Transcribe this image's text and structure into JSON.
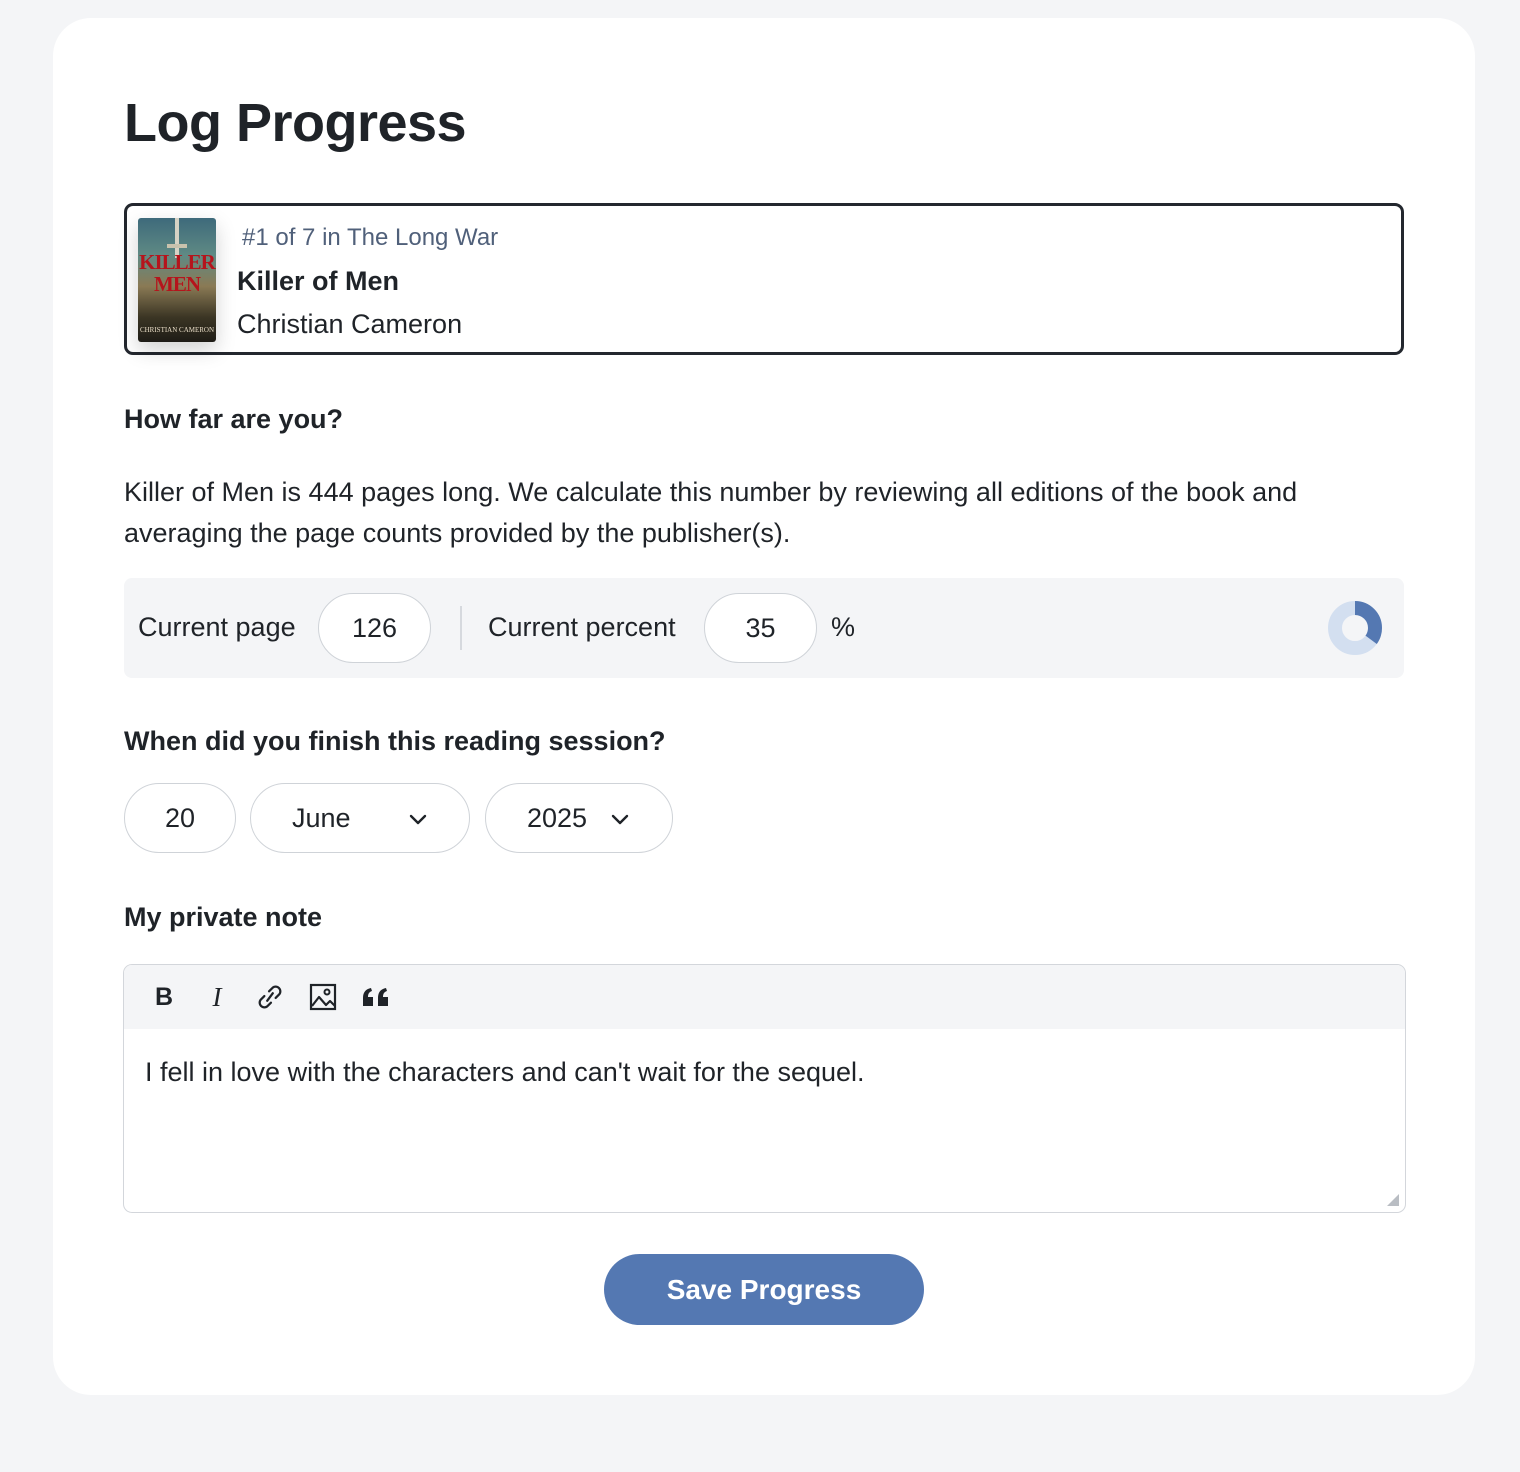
{
  "page": {
    "title": "Log Progress"
  },
  "book": {
    "series": "#1 of 7 in The Long War",
    "title": "Killer of Men",
    "author": "Christian Cameron",
    "cover": {
      "line1": "KILLER",
      "line2": "MEN",
      "author": "CHRISTIAN CAMERON"
    }
  },
  "progress": {
    "heading": "How far are you?",
    "description": "Killer of Men is 444 pages long. We calculate this number by reviewing all editions of the book and averaging the page counts provided by the publisher(s).",
    "page_label": "Current page",
    "page_value": "126",
    "percent_label": "Current percent",
    "percent_value": "35",
    "percent_sign": "%",
    "fraction": 0.35
  },
  "session": {
    "heading": "When did you finish this reading session?",
    "day": "20",
    "month": "June",
    "year": "2025"
  },
  "note": {
    "heading": "My private note",
    "toolbar": {
      "bold": "B",
      "italic": "I"
    },
    "text": "I fell in love with the characters and can't wait for the sequel."
  },
  "actions": {
    "save_label": "Save Progress"
  },
  "colors": {
    "accent": "#5478b2",
    "donut_track": "#d3dff0",
    "border_dark": "#23272e"
  }
}
